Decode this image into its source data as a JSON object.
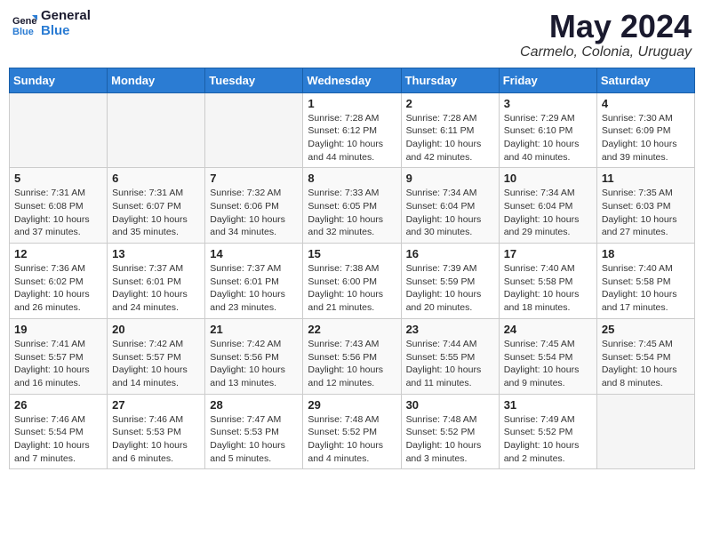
{
  "logo": {
    "line1": "General",
    "line2": "Blue"
  },
  "title": "May 2024",
  "location": "Carmelo, Colonia, Uruguay",
  "days_of_week": [
    "Sunday",
    "Monday",
    "Tuesday",
    "Wednesday",
    "Thursday",
    "Friday",
    "Saturday"
  ],
  "weeks": [
    [
      {
        "day": "",
        "info": ""
      },
      {
        "day": "",
        "info": ""
      },
      {
        "day": "",
        "info": ""
      },
      {
        "day": "1",
        "info": "Sunrise: 7:28 AM\nSunset: 6:12 PM\nDaylight: 10 hours\nand 44 minutes."
      },
      {
        "day": "2",
        "info": "Sunrise: 7:28 AM\nSunset: 6:11 PM\nDaylight: 10 hours\nand 42 minutes."
      },
      {
        "day": "3",
        "info": "Sunrise: 7:29 AM\nSunset: 6:10 PM\nDaylight: 10 hours\nand 40 minutes."
      },
      {
        "day": "4",
        "info": "Sunrise: 7:30 AM\nSunset: 6:09 PM\nDaylight: 10 hours\nand 39 minutes."
      }
    ],
    [
      {
        "day": "5",
        "info": "Sunrise: 7:31 AM\nSunset: 6:08 PM\nDaylight: 10 hours\nand 37 minutes."
      },
      {
        "day": "6",
        "info": "Sunrise: 7:31 AM\nSunset: 6:07 PM\nDaylight: 10 hours\nand 35 minutes."
      },
      {
        "day": "7",
        "info": "Sunrise: 7:32 AM\nSunset: 6:06 PM\nDaylight: 10 hours\nand 34 minutes."
      },
      {
        "day": "8",
        "info": "Sunrise: 7:33 AM\nSunset: 6:05 PM\nDaylight: 10 hours\nand 32 minutes."
      },
      {
        "day": "9",
        "info": "Sunrise: 7:34 AM\nSunset: 6:04 PM\nDaylight: 10 hours\nand 30 minutes."
      },
      {
        "day": "10",
        "info": "Sunrise: 7:34 AM\nSunset: 6:04 PM\nDaylight: 10 hours\nand 29 minutes."
      },
      {
        "day": "11",
        "info": "Sunrise: 7:35 AM\nSunset: 6:03 PM\nDaylight: 10 hours\nand 27 minutes."
      }
    ],
    [
      {
        "day": "12",
        "info": "Sunrise: 7:36 AM\nSunset: 6:02 PM\nDaylight: 10 hours\nand 26 minutes."
      },
      {
        "day": "13",
        "info": "Sunrise: 7:37 AM\nSunset: 6:01 PM\nDaylight: 10 hours\nand 24 minutes."
      },
      {
        "day": "14",
        "info": "Sunrise: 7:37 AM\nSunset: 6:01 PM\nDaylight: 10 hours\nand 23 minutes."
      },
      {
        "day": "15",
        "info": "Sunrise: 7:38 AM\nSunset: 6:00 PM\nDaylight: 10 hours\nand 21 minutes."
      },
      {
        "day": "16",
        "info": "Sunrise: 7:39 AM\nSunset: 5:59 PM\nDaylight: 10 hours\nand 20 minutes."
      },
      {
        "day": "17",
        "info": "Sunrise: 7:40 AM\nSunset: 5:58 PM\nDaylight: 10 hours\nand 18 minutes."
      },
      {
        "day": "18",
        "info": "Sunrise: 7:40 AM\nSunset: 5:58 PM\nDaylight: 10 hours\nand 17 minutes."
      }
    ],
    [
      {
        "day": "19",
        "info": "Sunrise: 7:41 AM\nSunset: 5:57 PM\nDaylight: 10 hours\nand 16 minutes."
      },
      {
        "day": "20",
        "info": "Sunrise: 7:42 AM\nSunset: 5:57 PM\nDaylight: 10 hours\nand 14 minutes."
      },
      {
        "day": "21",
        "info": "Sunrise: 7:42 AM\nSunset: 5:56 PM\nDaylight: 10 hours\nand 13 minutes."
      },
      {
        "day": "22",
        "info": "Sunrise: 7:43 AM\nSunset: 5:56 PM\nDaylight: 10 hours\nand 12 minutes."
      },
      {
        "day": "23",
        "info": "Sunrise: 7:44 AM\nSunset: 5:55 PM\nDaylight: 10 hours\nand 11 minutes."
      },
      {
        "day": "24",
        "info": "Sunrise: 7:45 AM\nSunset: 5:54 PM\nDaylight: 10 hours\nand 9 minutes."
      },
      {
        "day": "25",
        "info": "Sunrise: 7:45 AM\nSunset: 5:54 PM\nDaylight: 10 hours\nand 8 minutes."
      }
    ],
    [
      {
        "day": "26",
        "info": "Sunrise: 7:46 AM\nSunset: 5:54 PM\nDaylight: 10 hours\nand 7 minutes."
      },
      {
        "day": "27",
        "info": "Sunrise: 7:46 AM\nSunset: 5:53 PM\nDaylight: 10 hours\nand 6 minutes."
      },
      {
        "day": "28",
        "info": "Sunrise: 7:47 AM\nSunset: 5:53 PM\nDaylight: 10 hours\nand 5 minutes."
      },
      {
        "day": "29",
        "info": "Sunrise: 7:48 AM\nSunset: 5:52 PM\nDaylight: 10 hours\nand 4 minutes."
      },
      {
        "day": "30",
        "info": "Sunrise: 7:48 AM\nSunset: 5:52 PM\nDaylight: 10 hours\nand 3 minutes."
      },
      {
        "day": "31",
        "info": "Sunrise: 7:49 AM\nSunset: 5:52 PM\nDaylight: 10 hours\nand 2 minutes."
      },
      {
        "day": "",
        "info": ""
      }
    ]
  ]
}
